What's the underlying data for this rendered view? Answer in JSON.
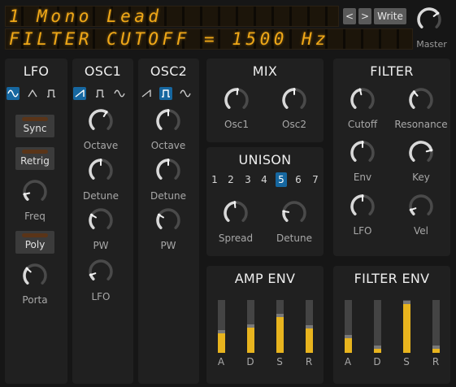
{
  "header": {
    "patch_display": "1 Mono Lead",
    "param_display": "FILTER CUTOFF = 1500 Hz",
    "prev_label": "<",
    "next_label": ">",
    "write_label": "Write",
    "master_label": "Master",
    "master_value": 0.7
  },
  "lfo": {
    "title": "LFO",
    "waves": [
      "sine-wave-icon",
      "triangle-wave-icon",
      "square-wave-icon"
    ],
    "selected_wave": 0,
    "sync_label": "Sync",
    "retrig_label": "Retrig",
    "freq_label": "Freq",
    "freq_value": 0.12,
    "poly_label": "Poly",
    "porta_label": "Porta",
    "porta_value": 0.32
  },
  "osc1": {
    "title": "OSC1",
    "waves": [
      "saw-wave-icon",
      "square-wave-icon",
      "sine-wave-icon"
    ],
    "selected_wave": 0,
    "octave_label": "Octave",
    "octave_value": 0.62,
    "detune_label": "Detune",
    "detune_value": 0.5,
    "pw_label": "PW",
    "pw_value": 0.28,
    "lfo_label": "LFO",
    "lfo_value": 0.1
  },
  "osc2": {
    "title": "OSC2",
    "waves": [
      "saw-wave-icon",
      "square-wave-icon",
      "sine-wave-icon"
    ],
    "selected_wave": 1,
    "octave_label": "Octave",
    "octave_value": 0.5,
    "detune_label": "Detune",
    "detune_value": 0.5,
    "pw_label": "PW",
    "pw_value": 0.28
  },
  "mix": {
    "title": "MIX",
    "osc1_label": "Osc1",
    "osc1_value": 0.52,
    "osc2_label": "Osc2",
    "osc2_value": 0.5
  },
  "unison": {
    "title": "UNISON",
    "voices": [
      "1",
      "2",
      "3",
      "4",
      "5",
      "6",
      "7"
    ],
    "selected_voice": 4,
    "spread_label": "Spread",
    "spread_value": 0.48,
    "detune_label": "Detune",
    "detune_value": 0.2
  },
  "filter": {
    "title": "FILTER",
    "cutoff_label": "Cutoff",
    "cutoff_value": 0.45,
    "resonance_label": "Resonance",
    "resonance_value": 0.35,
    "env_label": "Env",
    "env_value": 0.5,
    "key_label": "Key",
    "key_value": 0.78,
    "lfo_label": "LFO",
    "lfo_value": 0.5,
    "vel_label": "Vel",
    "vel_value": 0.1
  },
  "amp_env": {
    "title": "AMP ENV",
    "sliders": [
      {
        "label": "A",
        "value": 0.37
      },
      {
        "label": "D",
        "value": 0.48
      },
      {
        "label": "S",
        "value": 0.68
      },
      {
        "label": "R",
        "value": 0.46
      }
    ]
  },
  "filter_env": {
    "title": "FILTER ENV",
    "sliders": [
      {
        "label": "A",
        "value": 0.28
      },
      {
        "label": "D",
        "value": 0.08
      },
      {
        "label": "S",
        "value": 0.93
      },
      {
        "label": "R",
        "value": 0.08
      }
    ]
  },
  "colors": {
    "lcd_text": "#f0a818",
    "accent_blue": "#1667a0",
    "slider_fill": "#e8b41e",
    "panel_bg": "#202020",
    "app_bg": "#161616"
  }
}
